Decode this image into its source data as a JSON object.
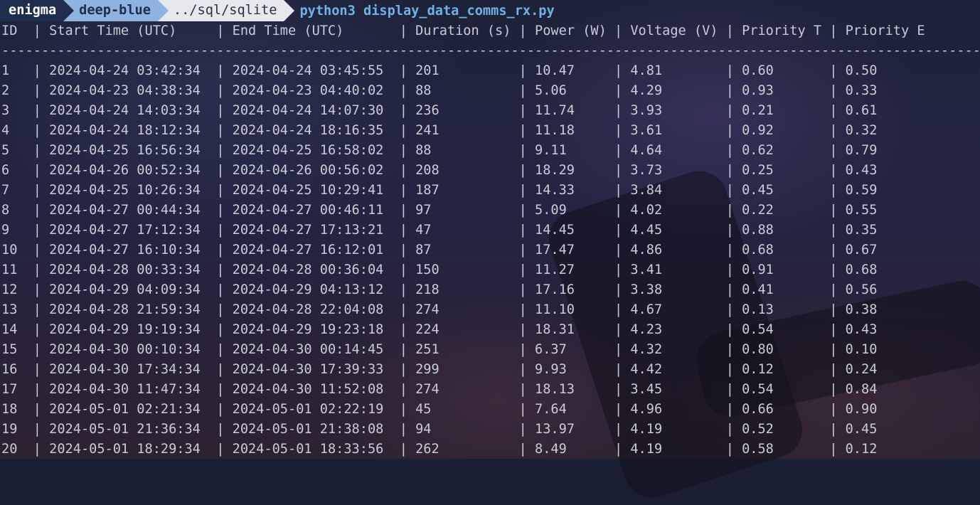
{
  "prompt": {
    "host": "enigma",
    "theme": "deep-blue",
    "path": "../sql/sqlite",
    "command": "python3 display_data_comms_rx.py"
  },
  "table": {
    "header_line": "ID  | Start Time (UTC)     | End Time (UTC)       | Duration (s) | Power (W) | Voltage (V) | Priority T | Priority E",
    "separator_line": "---------------------------------------------------------------------------------------------------------------------------------",
    "columns": [
      "ID",
      "Start Time (UTC)",
      "End Time (UTC)",
      "Duration (s)",
      "Power (W)",
      "Voltage (V)",
      "Priority T",
      "Priority E"
    ],
    "rows": [
      [
        "1",
        "2024-04-24 03:42:34",
        "2024-04-24 03:45:55",
        "201",
        "10.47",
        "4.81",
        "0.60",
        "0.50"
      ],
      [
        "2",
        "2024-04-23 04:38:34",
        "2024-04-23 04:40:02",
        "88",
        "5.06",
        "4.29",
        "0.93",
        "0.33"
      ],
      [
        "3",
        "2024-04-24 14:03:34",
        "2024-04-24 14:07:30",
        "236",
        "11.74",
        "3.93",
        "0.21",
        "0.61"
      ],
      [
        "4",
        "2024-04-24 18:12:34",
        "2024-04-24 18:16:35",
        "241",
        "11.18",
        "3.61",
        "0.92",
        "0.32"
      ],
      [
        "5",
        "2024-04-25 16:56:34",
        "2024-04-25 16:58:02",
        "88",
        "9.11",
        "4.64",
        "0.62",
        "0.79"
      ],
      [
        "6",
        "2024-04-26 00:52:34",
        "2024-04-26 00:56:02",
        "208",
        "18.29",
        "3.73",
        "0.25",
        "0.43"
      ],
      [
        "7",
        "2024-04-25 10:26:34",
        "2024-04-25 10:29:41",
        "187",
        "14.33",
        "3.84",
        "0.45",
        "0.59"
      ],
      [
        "8",
        "2024-04-27 00:44:34",
        "2024-04-27 00:46:11",
        "97",
        "5.09",
        "4.02",
        "0.22",
        "0.55"
      ],
      [
        "9",
        "2024-04-27 17:12:34",
        "2024-04-27 17:13:21",
        "47",
        "14.45",
        "4.45",
        "0.88",
        "0.35"
      ],
      [
        "10",
        "2024-04-27 16:10:34",
        "2024-04-27 16:12:01",
        "87",
        "17.47",
        "4.86",
        "0.68",
        "0.67"
      ],
      [
        "11",
        "2024-04-28 00:33:34",
        "2024-04-28 00:36:04",
        "150",
        "11.27",
        "3.41",
        "0.91",
        "0.68"
      ],
      [
        "12",
        "2024-04-29 04:09:34",
        "2024-04-29 04:13:12",
        "218",
        "17.16",
        "3.38",
        "0.41",
        "0.56"
      ],
      [
        "13",
        "2024-04-28 21:59:34",
        "2024-04-28 22:04:08",
        "274",
        "11.10",
        "4.67",
        "0.13",
        "0.38"
      ],
      [
        "14",
        "2024-04-29 19:19:34",
        "2024-04-29 19:23:18",
        "224",
        "18.31",
        "4.23",
        "0.54",
        "0.43"
      ],
      [
        "15",
        "2024-04-30 00:10:34",
        "2024-04-30 00:14:45",
        "251",
        "6.37",
        "4.32",
        "0.80",
        "0.10"
      ],
      [
        "16",
        "2024-04-30 17:34:34",
        "2024-04-30 17:39:33",
        "299",
        "9.93",
        "4.42",
        "0.12",
        "0.24"
      ],
      [
        "17",
        "2024-04-30 11:47:34",
        "2024-04-30 11:52:08",
        "274",
        "18.13",
        "3.45",
        "0.54",
        "0.84"
      ],
      [
        "18",
        "2024-05-01 02:21:34",
        "2024-05-01 02:22:19",
        "45",
        "7.64",
        "4.96",
        "0.66",
        "0.90"
      ],
      [
        "19",
        "2024-05-01 21:36:34",
        "2024-05-01 21:38:08",
        "94",
        "13.97",
        "4.19",
        "0.52",
        "0.45"
      ],
      [
        "20",
        "2024-05-01 18:29:34",
        "2024-05-01 18:33:56",
        "262",
        "8.49",
        "4.19",
        "0.58",
        "0.12"
      ]
    ]
  },
  "colors": {
    "host_bg": "#1f2d4f",
    "theme_bg": "#8fb3e0",
    "path_bg": "#e6e8ee",
    "command": "#6fb3e6",
    "text": "#c8ccd6"
  }
}
